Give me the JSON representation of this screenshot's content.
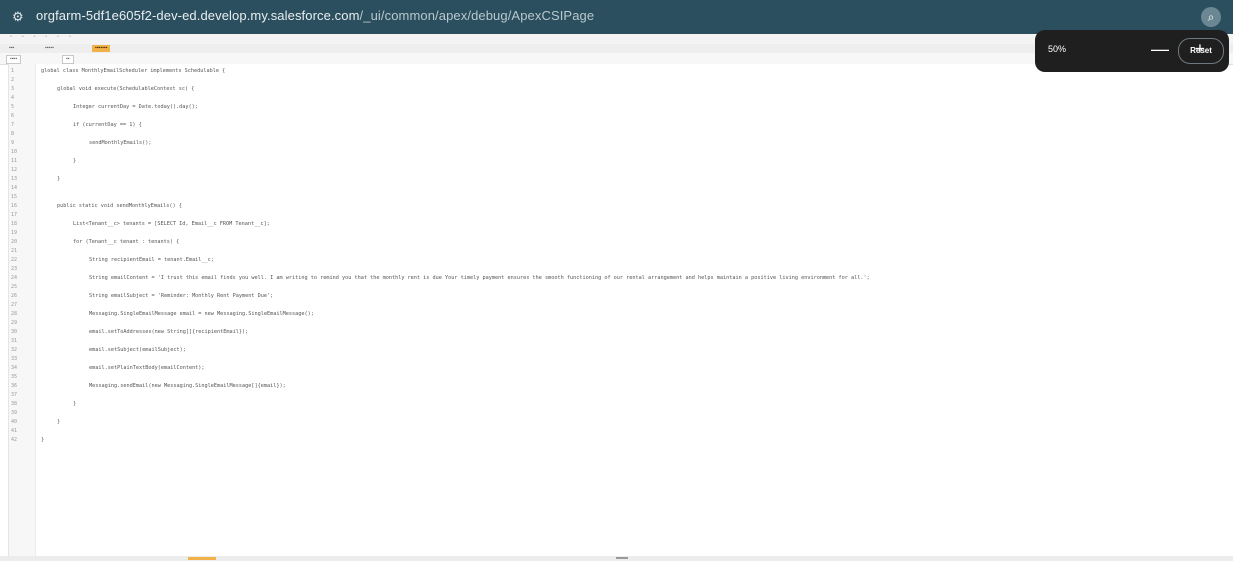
{
  "browser": {
    "url_host": "orgfarm-5df1e605f2-dev-ed.develop.my.salesforce.com",
    "url_path": "/_ui/common/apex/debug/ApexCSIPage"
  },
  "zoom": {
    "level": "50%",
    "minus": "—",
    "plus": "+",
    "reset": "Reset"
  },
  "code_lines": [
    {
      "n": "1",
      "t": "global class MonthlyEmailScheduler implements Schedulable {"
    },
    {
      "n": "2",
      "t": ""
    },
    {
      "n": "3",
      "t": "global void execute(SchedulableContext sc) {"
    },
    {
      "n": "4",
      "t": ""
    },
    {
      "n": "5",
      "t": "Integer currentDay = Date.today().day();"
    },
    {
      "n": "6",
      "t": ""
    },
    {
      "n": "7",
      "t": "if (currentDay == 1) {"
    },
    {
      "n": "8",
      "t": ""
    },
    {
      "n": "9",
      "t": "sendMonthlyEmails();"
    },
    {
      "n": "10",
      "t": ""
    },
    {
      "n": "11",
      "t": "}"
    },
    {
      "n": "12",
      "t": ""
    },
    {
      "n": "13",
      "t": "}"
    },
    {
      "n": "14",
      "t": ""
    },
    {
      "n": "15",
      "t": ""
    },
    {
      "n": "16",
      "t": "public static void sendMonthlyEmails() {"
    },
    {
      "n": "17",
      "t": ""
    },
    {
      "n": "18",
      "t": "List<Tenant__c> tenants = [SELECT Id, Email__c FROM Tenant__c];"
    },
    {
      "n": "19",
      "t": ""
    },
    {
      "n": "20",
      "t": "for (Tenant__c tenant : tenants) {"
    },
    {
      "n": "21",
      "t": ""
    },
    {
      "n": "22",
      "t": "String recipientEmail = tenant.Email__c;"
    },
    {
      "n": "23",
      "t": ""
    },
    {
      "n": "24",
      "t": "String emailContent = 'I trust this email finds you well. I am writing to remind you that the monthly rent is due Your timely payment ensures the smooth functioning of our rental arrangement and helps maintain a positive living environment for all.';"
    },
    {
      "n": "25",
      "t": ""
    },
    {
      "n": "26",
      "t": "String emailSubject = 'Reminder: Monthly Rent Payment Due';"
    },
    {
      "n": "27",
      "t": ""
    },
    {
      "n": "28",
      "t": "Messaging.SingleEmailMessage email = new Messaging.SingleEmailMessage();"
    },
    {
      "n": "29",
      "t": ""
    },
    {
      "n": "30",
      "t": "email.setToAddresses(new String[]{recipientEmail});"
    },
    {
      "n": "31",
      "t": ""
    },
    {
      "n": "32",
      "t": "email.setSubject(emailSubject);"
    },
    {
      "n": "33",
      "t": ""
    },
    {
      "n": "34",
      "t": "email.setPlainTextBody(emailContent);"
    },
    {
      "n": "35",
      "t": ""
    },
    {
      "n": "36",
      "t": "Messaging.sendEmail(new Messaging.SingleEmailMessage[]{email});"
    },
    {
      "n": "37",
      "t": ""
    },
    {
      "n": "38",
      "t": "}"
    },
    {
      "n": "39",
      "t": ""
    },
    {
      "n": "40",
      "t": "}"
    },
    {
      "n": "41",
      "t": ""
    },
    {
      "n": "42",
      "t": "}"
    }
  ]
}
